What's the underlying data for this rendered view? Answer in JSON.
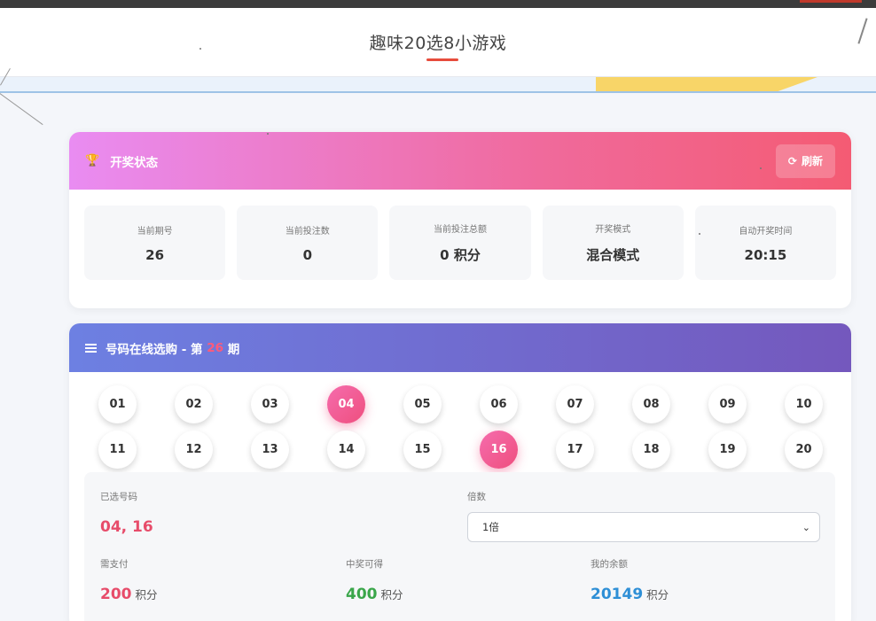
{
  "page": {
    "title": "趣味20选8小游戏"
  },
  "status_card": {
    "title": "开奖状态",
    "refresh_label": "刷新",
    "stats": [
      {
        "label": "当前期号",
        "value": "26"
      },
      {
        "label": "当前投注数",
        "value": "0"
      },
      {
        "label": "当前投注总额",
        "value": "0 积分"
      },
      {
        "label": "开奖模式",
        "value": "混合模式"
      },
      {
        "label": "自动开奖时间",
        "value": "20:15"
      }
    ]
  },
  "selection_card": {
    "title_prefix": "号码在线选购 - 第",
    "period": "26",
    "title_suffix": "期",
    "numbers_row1": [
      "01",
      "02",
      "03",
      "04",
      "05",
      "06",
      "07",
      "08",
      "09",
      "10"
    ],
    "numbers_row2": [
      "11",
      "12",
      "13",
      "14",
      "15",
      "16",
      "17",
      "18",
      "19",
      "20"
    ],
    "selected": [
      "04",
      "16"
    ],
    "selected_label": "已选号码",
    "selected_value": "04, 16",
    "multiplier_label": "倍数",
    "multiplier_value": "1倍",
    "pay_label": "需支付",
    "pay_value": "200",
    "win_label": "中奖可得",
    "win_value": "400",
    "balance_label": "我的余额",
    "balance_value": "20149",
    "unit": "积分"
  },
  "colors": {
    "status_gradient_start": "#e98cf2",
    "status_gradient_end": "#f45b73",
    "selection_gradient_start": "#6d80e2",
    "selection_gradient_end": "#7458bd",
    "selected_ball": "#ef4f7e",
    "pay": "#e74c6a",
    "win": "#3aa64a",
    "balance": "#2e8fd6"
  }
}
